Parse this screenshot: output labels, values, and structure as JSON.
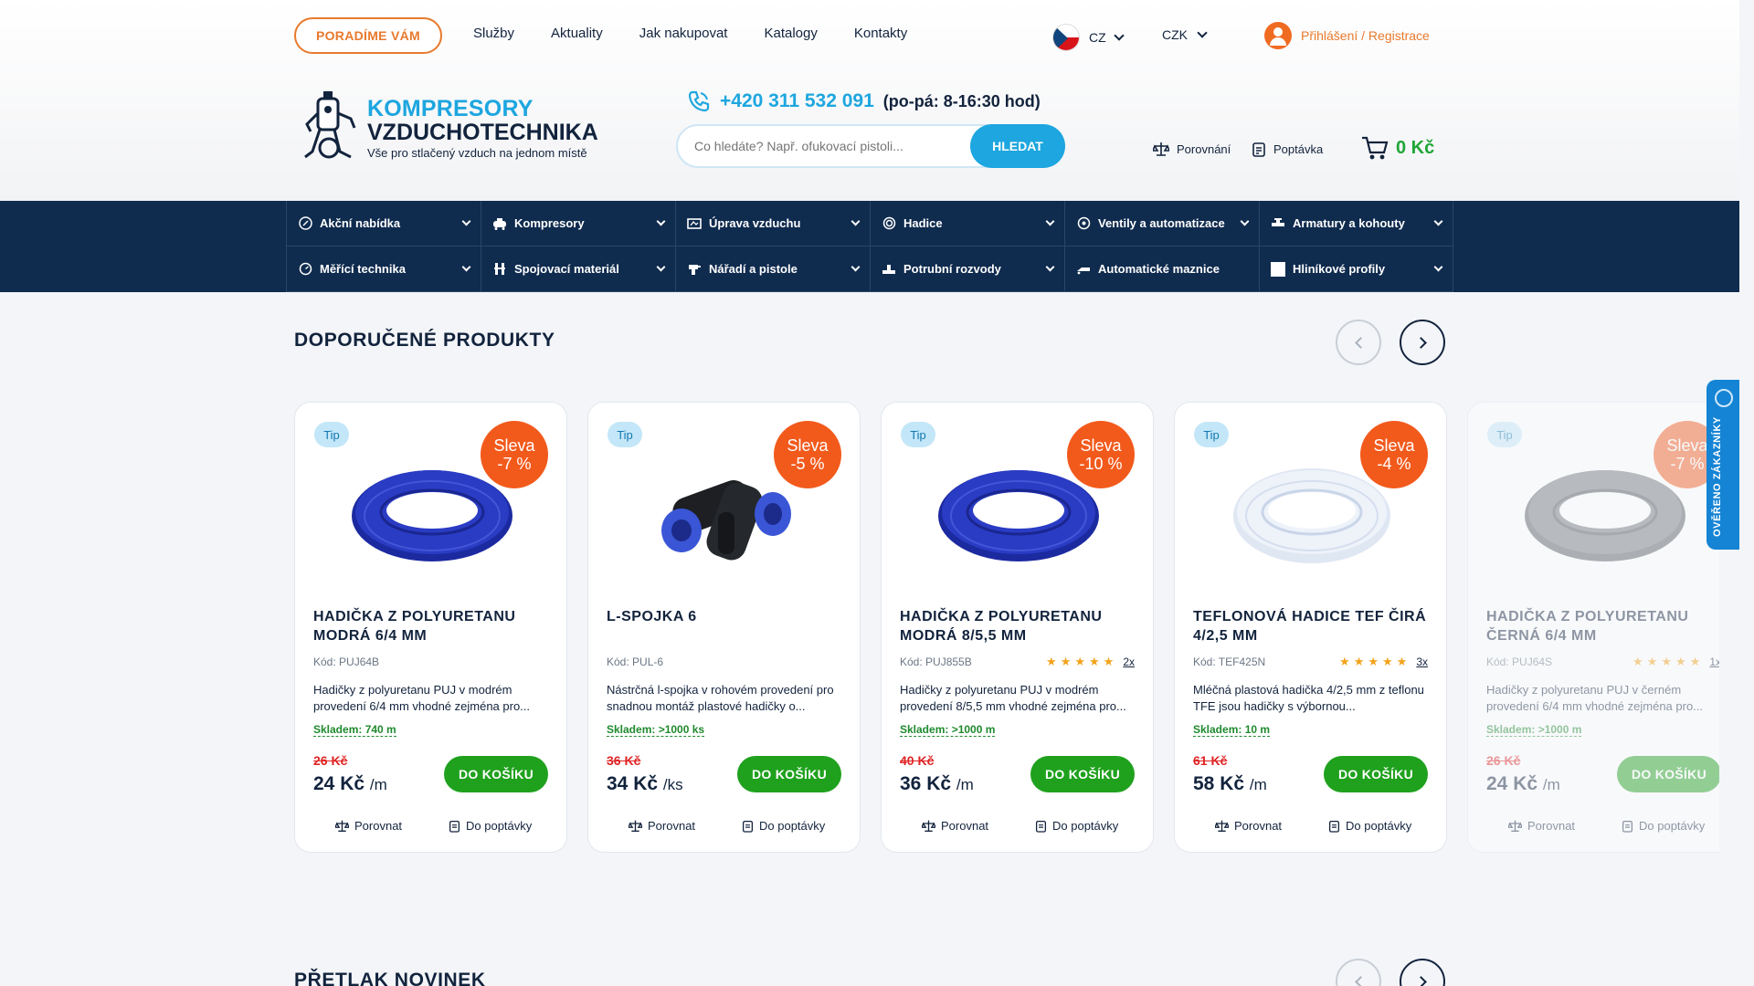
{
  "header": {
    "advise_label": "PORADÍME VÁM",
    "nav": [
      "Služby",
      "Aktuality",
      "Jak nakupovat",
      "Katalogy",
      "Kontakty"
    ],
    "language": "CZ",
    "currency": "CZK",
    "login_label": "Přihlášení / Registrace",
    "logo_line1": "KOMPRESORY",
    "logo_line2": "VZDUCHOTECHNIKA",
    "logo_tagline": "Vše pro stlačený vzduch na jednom místě",
    "phone": "+420 311 532 091",
    "phone_hours": "(po-pá: 8-16:30 hod)",
    "search_placeholder": "Co hledáte? Např. ofukovací pistoli...",
    "search_button": "HLEDAT",
    "compare_label": "Porovnání",
    "inquiry_label": "Poptávka",
    "cart_total": "0 Kč"
  },
  "menu": [
    {
      "label": "Akční nabídka",
      "icon": "percent-icon"
    },
    {
      "label": "Kompresory",
      "icon": "compressor-icon"
    },
    {
      "label": "Úprava vzduchu",
      "icon": "air-treatment-icon"
    },
    {
      "label": "Hadice",
      "icon": "hose-icon"
    },
    {
      "label": "Ventily a automatizace",
      "icon": "valve-icon"
    },
    {
      "label": "Armatury a kohouty",
      "icon": "faucet-icon"
    },
    {
      "label": "Měřící technika",
      "icon": "gauge-icon"
    },
    {
      "label": "Spojovací materiál",
      "icon": "fitting-icon"
    },
    {
      "label": "Nářadí a pistole",
      "icon": "tool-icon"
    },
    {
      "label": "Potrubní rozvody",
      "icon": "pipe-icon"
    },
    {
      "label": "Automatické maznice",
      "icon": "lubricator-icon"
    },
    {
      "label": "Hliníkové profily",
      "icon": "profile-icon"
    }
  ],
  "recommended": {
    "title": "DOPORUČENÉ PRODUKTY",
    "products": [
      {
        "tip": "Tip",
        "sale_line1": "Sleva",
        "sale_line2": "-7 %",
        "name": "HADIČKA Z POLYURETANU MODRÁ 6/4 MM",
        "code": "Kód: PUJ64B",
        "rating": 0,
        "rating_count": "",
        "desc": "Hadičky z polyuretanu PUJ v modrém provedení 6/4 mm vhodné zejména pro...",
        "stock": "Skladem: 740 m",
        "old_price": "26 Kč",
        "price": "24 Kč",
        "unit": "/m",
        "buy": "DO KOŠÍKU",
        "compare": "Porovnat",
        "inquiry": "Do poptávky",
        "image": "blue-hose"
      },
      {
        "tip": "Tip",
        "sale_line1": "Sleva",
        "sale_line2": "-5 %",
        "name": "L-SPOJKA 6",
        "code": "Kód: PUL-6",
        "rating": 0,
        "rating_count": "",
        "desc": "Nástrčná l-spojka v rohovém provedení pro snadnou montáž plastové hadičky o...",
        "stock": "Skladem: >1000 ks",
        "old_price": "36 Kč",
        "price": "34 Kč",
        "unit": "/ks",
        "buy": "DO KOŠÍKU",
        "compare": "Porovnat",
        "inquiry": "Do poptávky",
        "image": "l-fitting"
      },
      {
        "tip": "Tip",
        "sale_line1": "Sleva",
        "sale_line2": "-10 %",
        "name": "HADIČKA Z POLYURETANU MODRÁ 8/5,5 MM",
        "code": "Kód: PUJ855B",
        "rating": 5,
        "rating_count": "2x",
        "desc": "Hadičky z polyuretanu PUJ v modrém provedení 8/5,5 mm vhodné zejména pro...",
        "stock": "Skladem: >1000 m",
        "old_price": "40 Kč",
        "price": "36 Kč",
        "unit": "/m",
        "buy": "DO KOŠÍKU",
        "compare": "Porovnat",
        "inquiry": "Do poptávky",
        "image": "blue-hose"
      },
      {
        "tip": "Tip",
        "sale_line1": "Sleva",
        "sale_line2": "-4 %",
        "name": "TEFLONOVÁ HADICE TEF ČIRÁ 4/2,5 MM",
        "code": "Kód: TEF425N",
        "rating": 5,
        "rating_count": "3x",
        "desc": "Mléčná plastová hadička 4/2,5 mm z teflonu TFE jsou hadičky s výbornou...",
        "stock": "Skladem: 10 m",
        "old_price": "61 Kč",
        "price": "58 Kč",
        "unit": "/m",
        "buy": "DO KOŠÍKU",
        "compare": "Porovnat",
        "inquiry": "Do poptávky",
        "image": "clear-hose"
      },
      {
        "tip": "Tip",
        "sale_line1": "Sleva",
        "sale_line2": "-7 %",
        "name": "HADIČKA Z POLYURETANU ČERNÁ 6/4 MM",
        "code": "Kód: PUJ64S",
        "rating": 5,
        "rating_count": "1x",
        "desc": "Hadičky z polyuretanu PUJ v černém provedení 6/4 mm vhodné zejména pro...",
        "stock": "Skladem: >1000 m",
        "old_price": "26 Kč",
        "price": "24 Kč",
        "unit": "/m",
        "buy": "DO KOŠÍKU",
        "compare": "Porovnat",
        "inquiry": "Do poptávky",
        "image": "gray-hose"
      }
    ]
  },
  "news": {
    "title": "PŘETLAK NOVINEK"
  },
  "verified_label": "OVĚŘENO ZÁKAZNÍKY",
  "colors": {
    "accent": "#1da6df",
    "orange": "#e8792c",
    "navy": "#0f2b4e",
    "green": "#1fa11d",
    "sale": "#f25a1c"
  }
}
